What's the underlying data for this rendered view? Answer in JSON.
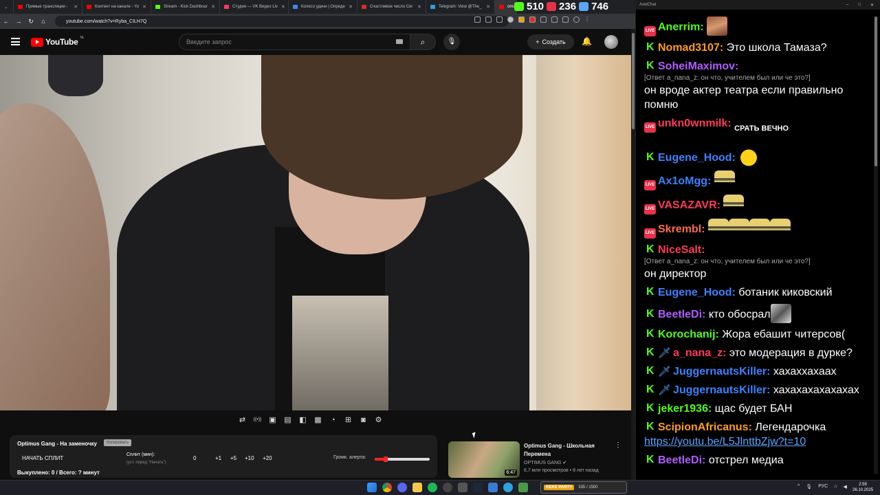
{
  "browser": {
    "tabs": [
      {
        "label": "Прямые трансляции -",
        "color": "#ff0000"
      },
      {
        "label": "Контент на канале - Yo",
        "color": "#ff0000"
      },
      {
        "label": "Stream - Kick Dashboar",
        "color": "#53fc18"
      },
      {
        "label": "Студия — VK Видео Liv",
        "color": "#ff3b5c"
      },
      {
        "label": "Колесо удачи | Опреде",
        "color": "#4285f4"
      },
      {
        "label": "Счастливое число Сег",
        "color": "#d93025"
      },
      {
        "label": "Telegram: View @The_",
        "color": "#2aa3df"
      },
      {
        "label": "omu",
        "color": "#ff0000"
      }
    ],
    "url": "youtube.com/watch?v=Ryba_CILH7Q"
  },
  "stream_stats": {
    "kick_viewers": "510",
    "live_viewers": "236",
    "total_viewers": "746",
    "kick_color": "#53fc18",
    "live_color": "#e8314a",
    "total_color": "#5aa5ff"
  },
  "youtube": {
    "logo_text": "YouTube",
    "region": "NL",
    "search_placeholder": "Введите запрос",
    "create_label": "Создать"
  },
  "player_controls": [
    "repeat-icon",
    "broadcast-icon",
    "radio-icon",
    "clapper-icon",
    "screen-icon",
    "film-icon",
    "speed-icon",
    "loop-icon",
    "camera-icon",
    "gear-icon"
  ],
  "alert_panel": {
    "title": "Optimus Gang - На заменочку",
    "badge": "Копировать",
    "start_label": "НАЧАТЬ СПЛИТ",
    "split_label": "Сплит (мин):",
    "split_hint": "(уст. перед \"Начать\")",
    "values": [
      "0",
      "+1",
      "+5",
      "+10",
      "+20"
    ],
    "volume_label": "Громк. алерта:",
    "volume_level": 0.2,
    "sold_label": "Выкуплено: 0 / Всего: ? минут"
  },
  "recommendation": {
    "title": "Optimus Gang - Школьная Перемена",
    "channel": "OPTIMUS GANG",
    "meta": "6,7 млн просмотров • 8 лет назад",
    "duration": "6:47"
  },
  "chat": {
    "window_title": "AxelChat",
    "messages": [
      {
        "platform": "live",
        "user": "Anerrim:",
        "color": "#53fc18",
        "text": "",
        "emotes": [
          "face"
        ]
      },
      {
        "platform": "kick",
        "user": "Nomad3107:",
        "color": "#ff9f1a",
        "text": "Это школа Тамаза?"
      },
      {
        "platform": "kick",
        "user": "SoheiMaximov:",
        "color": "#b05cff",
        "reply": "[Ответ a_nana_z: он что, учителем был или че это?]",
        "text": "он вроде актер театра если правильно помню"
      },
      {
        "platform": "live",
        "user": "unkn0wnmilk:",
        "color": "#ff3b5c",
        "text": "",
        "emote_text": "СРАТЬ ВЕЧНО"
      },
      {
        "platform": "kick",
        "user": "Eugene_Hood:",
        "color": "#3b82ff",
        "text": "",
        "emotes": [
          "lemon"
        ]
      },
      {
        "platform": "live",
        "user": "Ax1oMgg:",
        "color": "#3b82ff",
        "text": "",
        "emotes": [
          "trophy"
        ]
      },
      {
        "platform": "live",
        "user": "VASAZAVR:",
        "color": "#ff3b5c",
        "text": "",
        "emotes": [
          "trophy"
        ]
      },
      {
        "platform": "live",
        "user": "Skrembl:",
        "color": "#ff6a4a",
        "text": "",
        "emotes": [
          "trophy",
          "trophy",
          "trophy",
          "trophy"
        ]
      },
      {
        "platform": "kick",
        "user": "NiceSalt:",
        "color": "#ff3b5c",
        "reply": "[Ответ a_nana_z: он что, учителем был или че это?]",
        "text": "он директор"
      },
      {
        "platform": "kick",
        "user": "Eugene_Hood:",
        "color": "#3b82ff",
        "text": "ботаник киковский"
      },
      {
        "platform": "kick",
        "user": "BeetleDi:",
        "color": "#b05cff",
        "text": "кто обосрал",
        "emotes": [
          "pic"
        ]
      },
      {
        "platform": "kick",
        "user": "Korochanij:",
        "color": "#53fc18",
        "text": "Жора ебашит читерсов("
      },
      {
        "platform": "kick",
        "user": "a_nana_z:",
        "color": "#ff3b5c",
        "mod": true,
        "text": "это модерация в дурке?"
      },
      {
        "platform": "kick",
        "user": "JuggernautsKiller:",
        "color": "#3b82ff",
        "mod": true,
        "text": "хахаххахаах"
      },
      {
        "platform": "kick",
        "user": "JuggernautsKiller:",
        "color": "#3b82ff",
        "mod": true,
        "text": "хахахахахахахах"
      },
      {
        "platform": "kick",
        "user": "jeker1936:",
        "color": "#53fc18",
        "text": "щас будет БАН"
      },
      {
        "platform": "kick",
        "user": "ScipionAfricanus:",
        "color": "#ff9f1a",
        "text": "Легендарочка",
        "link": "https://youtu.be/L5JlnttbZjw?t=10"
      },
      {
        "platform": "kick",
        "user": "BeetleDi:",
        "color": "#b05cff",
        "text": "отстрел медиа"
      }
    ]
  },
  "taskbar": {
    "banner_label": "KEKE PARTY",
    "banner_value": "335 / 1500",
    "lang": "РУС",
    "time": "2:59",
    "date": "26.10.2025"
  }
}
